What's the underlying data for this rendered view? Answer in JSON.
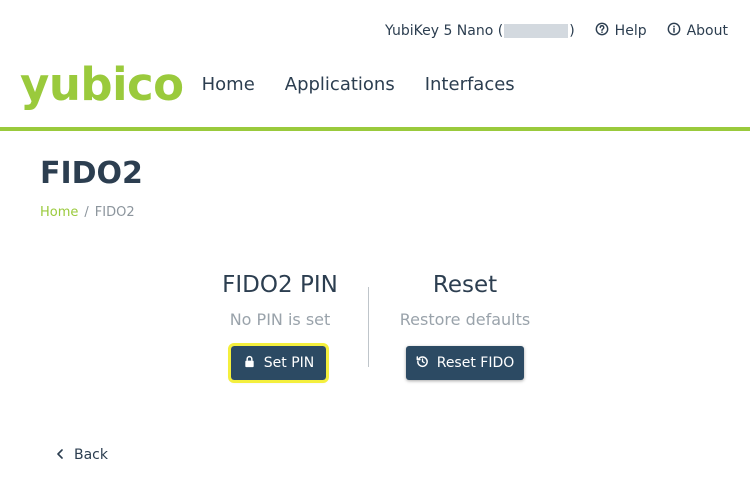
{
  "header": {
    "device_prefix": "YubiKey 5 Nano (",
    "device_suffix": ")",
    "help_label": "Help",
    "about_label": "About"
  },
  "brand": {
    "logo_text": "yubico",
    "color": "#9aca3c"
  },
  "nav": {
    "home": "Home",
    "applications": "Applications",
    "interfaces": "Interfaces"
  },
  "page": {
    "title": "FIDO2",
    "breadcrumb_home": "Home",
    "breadcrumb_separator": "/",
    "breadcrumb_current": "FIDO2"
  },
  "pin_section": {
    "title": "FIDO2 PIN",
    "status": "No PIN is set",
    "button_label": "Set PIN"
  },
  "reset_section": {
    "title": "Reset",
    "status": "Restore defaults",
    "button_label": "Reset FIDO"
  },
  "footer": {
    "back_label": "Back"
  },
  "colors": {
    "primary_button": "#2c4a63",
    "highlight": "#f4ef3d",
    "text": "#2c3e50"
  }
}
